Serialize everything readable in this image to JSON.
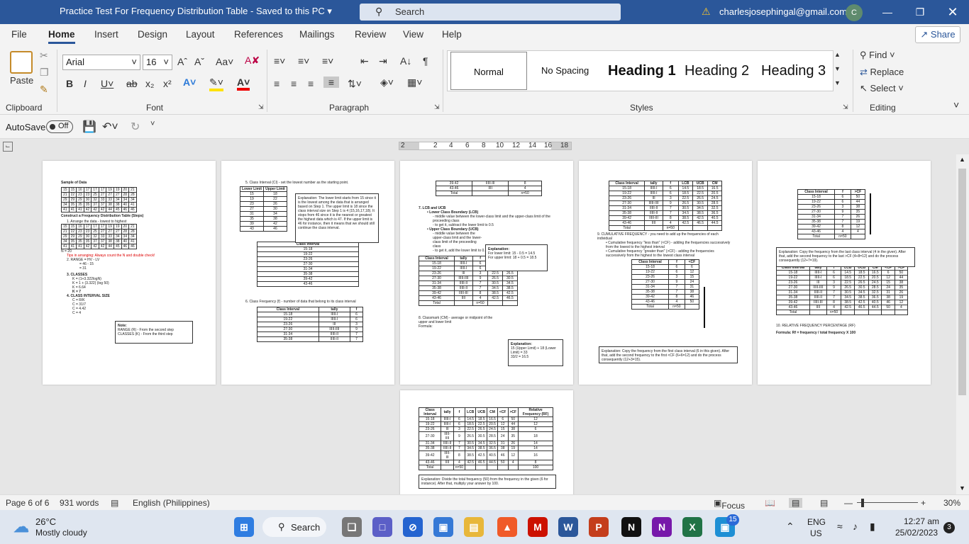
{
  "titlebar": {
    "doc_title": "Practice Test For Frequency Distribution Table  -  Saved to this PC  ▾",
    "search_placeholder": "Search",
    "user_email": "charlesjosephingal@gmail.com",
    "avatar_initial": "C"
  },
  "tabs": [
    "File",
    "Home",
    "Insert",
    "Design",
    "Layout",
    "References",
    "Mailings",
    "Review",
    "View",
    "Help"
  ],
  "share_label": "Share",
  "ribbon": {
    "paste_label": "Paste",
    "font_name": "Arial",
    "font_size": "16",
    "styles": [
      "Normal",
      "No Spacing",
      "Heading 1",
      "Heading 2",
      "Heading 3"
    ],
    "editing": {
      "find": "Find",
      "replace": "Replace",
      "select": "Select"
    },
    "groups": {
      "clipboard": "Clipboard",
      "font": "Font",
      "paragraph": "Paragraph",
      "styles": "Styles",
      "editing": "Editing"
    }
  },
  "qat": {
    "autosave_label": "AutoSave",
    "autosave_state": "Off"
  },
  "ruler_ticks": [
    "2",
    "2",
    "4",
    "6",
    "8",
    "10",
    "12",
    "14",
    "16",
    "18"
  ],
  "pages": {
    "p1": {
      "sample_title": "Sample of Data",
      "construct_title": "Construct a Frequency Distribution Table (Steps)",
      "step1": "1. Arrange the data - lowest to highest",
      "n": "N = 20",
      "tip": "Tips in arranging: Always count the N and double check!",
      "step2": "2. RANGE = HV - LV",
      "step2a": "= 46 - 15",
      "step2b": "= 31",
      "step3": "3. CLASSES",
      "step3a": "K = (1+3.322logN)",
      "step3b": "K = 1 + (3.322) (log 50)",
      "step3c": "K = 6.64",
      "step3d": "K = 7",
      "step4": "4. CLASS INTERVAL SIZE",
      "step4a": "C = R/K",
      "step4b": "C = 31/7",
      "step4c": "C = 4.42",
      "step4d": "C = 4",
      "note_title": "Note:",
      "note_range": "RANGE (R) - From the second step",
      "note_classes": "CLASSES (K) - From the third step"
    },
    "p2": {
      "step5": "5. Class Interval (CI) - set the lowest number as the starting point.",
      "col_lower": "Lower Limit",
      "col_upper": "Upper Limit",
      "explanation": "Explanation: The lower limit starts from 15 since it is the lowest among the data that is arranged based on Step 1. The upper limit is 18 since the class interval size on Step 1 is 4 (15,16,17,18). It stops from 46 since it is the nearest or greatest the highest data which is 47. If the upper limit is 46 for instance, then it means that we should still continue the class interval.",
      "ci_header": "Class Interval",
      "step6": "6. Class Frequency (f) - number of data that belong to its class interval",
      "col_ci": "Class Interval",
      "col_tally": "tally",
      "col_f": "f"
    },
    "p3": {
      "total": "Total",
      "n50": "n=50",
      "step7": "7. LCB and UCB",
      "lcb_title": "Lower Class Boundary (LCB)",
      "lcb_desc": "middle value between the lower-class limit and the upper-class limit of the proceeding class",
      "lcb_get": "to get it, subtract the lower limit to 0.5",
      "ucb_title": "Upper Class Boundary (UCB)",
      "ucb_desc": "middle value between the upper-class limit and the lower-class limit of the proceeding class",
      "ucb_get": "to get it, add the lower limit to 0.5",
      "exp_title": "Explanation:",
      "exp_lower": "For lower limit: 15 - 0.5 = 14.5",
      "exp_upper": "For upper limit: 18 + 0.5 = 18.5",
      "step8": "8. Classmark (CM) - average or midpoint of the upper and lower limit",
      "formula": "Formula:",
      "exp2_a": "15 (Upper Limit) + 18 (Lower Limit) = 33",
      "exp2_b": "33/2 = 16.5"
    },
    "p4": {
      "step9": "9. CUMULATIVE FREQUENCY - you need to add up the frequencies of each individual",
      "less": "Cumulative frequency \"less than\" (<CF) - adding the frequencies successively from the lowest to the highest interval",
      "greater": "Cumulative frequency \"greater than\" (>CF) - adding the frequencies successively from the highest to the lowest class interval",
      "explanation": "Explanation: Copy the frequency from the first class interval (6 in this given). After that, add the second frequency to the first <CF (6+6=12) and do the process consequently (12+3=15)."
    },
    "p5": {
      "explanation": "Explanation: Copy the frequency from the last class interval (4 in the given). After that, add the second frequency to the last >CF (4+8=12) and do the process consequently (12+7=19).",
      "step10": "10. RELATIVE FREQUENCY PERCENTAGE (RF)",
      "formula": "Formula: Rf = frequency / total frequency X 100"
    },
    "p6": {
      "explanation": "Explanation: Divide the total frequency (50) from the frequency in the given (6 for instance). After that, multiply your answer by 100."
    }
  },
  "class_intervals": [
    "15-18",
    "19-22",
    "23-26",
    "27-30",
    "31-34",
    "35-38",
    "39-42",
    "43-46"
  ],
  "tallies": [
    "IIIII-I",
    "IIIII-I",
    "III",
    "IIIII-IIII",
    "IIIII-II",
    "IIIII-II",
    "IIIII-III",
    "IIII"
  ],
  "frequencies": [
    "6",
    "6",
    "3",
    "9",
    "7",
    "7",
    "8",
    "4"
  ],
  "lcb": [
    "14.5",
    "18.5",
    "22.5",
    "26.5",
    "30.5",
    "34.5",
    "38.5",
    "42.5"
  ],
  "ucb": [
    "18.5",
    "22.5",
    "26.5",
    "30.5",
    "34.5",
    "38.5",
    "42.5",
    "46.5"
  ],
  "cm": [
    "16.5",
    "20.5",
    "24.5",
    "28.5",
    "32.5",
    "36.5",
    "40.5",
    "44.5"
  ],
  "less_cf": [
    "6",
    "12",
    "15",
    "24",
    "31",
    "38",
    "46",
    "50"
  ],
  "greater_cf": [
    "50",
    "44",
    "38",
    "35",
    "26",
    "19",
    "12",
    "4"
  ],
  "rf": [
    "12",
    "12",
    "6",
    "18",
    "14",
    "14",
    "16",
    "8"
  ],
  "lower_limits": [
    "15",
    "19",
    "23",
    "27",
    "31",
    "35",
    "39",
    "43"
  ],
  "upper_limits": [
    "18",
    "22",
    "26",
    "30",
    "34",
    "38",
    "42",
    "46"
  ],
  "sample_rows": [
    [
      "15",
      "15",
      "16",
      "17",
      "17",
      "17",
      "19",
      "19",
      "20",
      "21"
    ],
    [
      "21",
      "22",
      "23",
      "23",
      "25",
      "27",
      "27",
      "27",
      "28",
      "28"
    ],
    [
      "29",
      "29",
      "29",
      "30",
      "32",
      "33",
      "33",
      "34",
      "34",
      "34"
    ],
    [
      "34",
      "35",
      "35",
      "35",
      "37",
      "37",
      "38",
      "38",
      "40",
      "41"
    ],
    [
      "41",
      "41",
      "41",
      "42",
      "42",
      "42",
      "44",
      "45",
      "46",
      "46"
    ]
  ],
  "status": {
    "page": "Page 6 of 6",
    "words": "931 words",
    "language": "English (Philippines)",
    "focus": "Focus",
    "zoom": "30%"
  },
  "taskbar": {
    "temp": "26°C",
    "weather": "Mostly cloudy",
    "search": "Search",
    "lang1": "ENG",
    "lang2": "US",
    "time": "12:27 am",
    "date": "25/02/2023",
    "notif_count": "3",
    "badge_15": "15"
  }
}
